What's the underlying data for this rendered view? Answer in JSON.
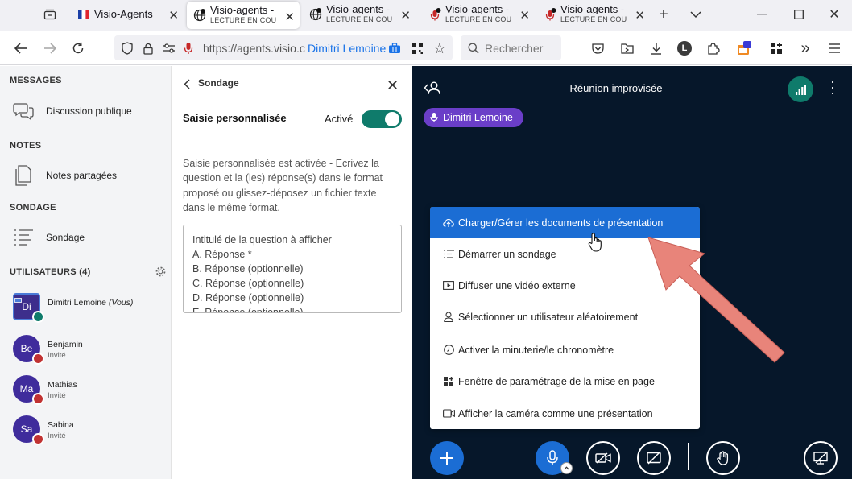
{
  "browser": {
    "tabs": [
      {
        "title": "Visio-Agents",
        "subtitle": ""
      },
      {
        "title": "Visio-agents - Ré",
        "subtitle": "LECTURE EN COURS"
      },
      {
        "title": "Visio-agents - Ré",
        "subtitle": "LECTURE EN COURS"
      },
      {
        "title": "Visio-agents - Ré",
        "subtitle": "LECTURE EN COURS"
      },
      {
        "title": "Visio-agents - Ré",
        "subtitle": "LECTURE EN COURS"
      }
    ],
    "url": "https://agents.visio.c",
    "url_user": "Dimitri Lemoine",
    "search_placeholder": "Rechercher",
    "extension_badge": "8",
    "profile_letter": "L"
  },
  "sidebar": {
    "messages_title": "MESSAGES",
    "public_chat": "Discussion publique",
    "notes_title": "NOTES",
    "shared_notes": "Notes partagées",
    "poll_title": "SONDAGE",
    "poll_item": "Sondage",
    "users_title": "UTILISATEURS (4)",
    "users": [
      {
        "initials": "Di",
        "name": "Dimitri Lemoine",
        "suffix": "(Vous)",
        "role": "",
        "color": "#3d2e8c"
      },
      {
        "initials": "Be",
        "name": "Benjamin",
        "suffix": "",
        "role": "Invité",
        "color": "#3f2c9c"
      },
      {
        "initials": "Ma",
        "name": "Mathias",
        "suffix": "",
        "role": "Invité",
        "color": "#3f2c9c"
      },
      {
        "initials": "Sa",
        "name": "Sabina",
        "suffix": "",
        "role": "Invité",
        "color": "#3f2c9c"
      }
    ]
  },
  "poll": {
    "header": "Sondage",
    "custom_input_label": "Saisie personnalisée",
    "toggle_label": "Activé",
    "description": "Saisie personnalisée est activée - Ecrivez la question et la (les) réponse(s) dans le format proposé ou glissez-déposez un fichier texte dans le même format.",
    "template_lines": [
      "Intitulé de la question à afficher",
      "A. Réponse *",
      "B. Réponse (optionnelle)",
      "C. Réponse (optionnelle)",
      "D. Réponse (optionnelle)",
      "E. Réponse (optionnelle)"
    ]
  },
  "meeting": {
    "title": "Réunion improvisée",
    "talker": "Dimitri Lemoine",
    "menu": [
      {
        "label": "Charger/Gérer les documents de présentation",
        "icon": "upload-icon"
      },
      {
        "label": "Démarrer un sondage",
        "icon": "poll-icon"
      },
      {
        "label": "Diffuser une vidéo externe",
        "icon": "video-icon"
      },
      {
        "label": "Sélectionner un utilisateur aléatoirement",
        "icon": "user-icon"
      },
      {
        "label": "Activer la minuterie/le chronomètre",
        "icon": "timer-icon"
      },
      {
        "label": "Fenêtre de paramétrage de la mise en page",
        "icon": "layout-icon"
      },
      {
        "label": "Afficher la caméra comme une présentation",
        "icon": "camera-icon"
      }
    ]
  },
  "colors": {
    "accent": "#1b6dd4",
    "teal": "#0f7b6b",
    "meeting_bg": "#06172a",
    "talker": "#6a3ec8",
    "arrow": "#e8847a"
  }
}
